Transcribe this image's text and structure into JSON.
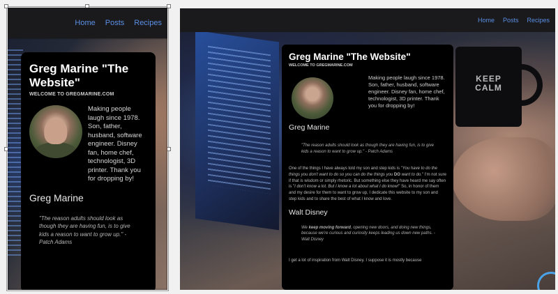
{
  "nav": {
    "items": [
      "Home",
      "Posts",
      "Recipes"
    ],
    "link_color": "#5b8fe5"
  },
  "site": {
    "title": "Greg Marine \"The Website\"",
    "subtitle": "WELCOME TO GREGMARINE.COM",
    "bio": "Making people laugh since 1978. Son, father, husband, software engineer. Disney fan, home chef, technologist, 3D printer. Thank you for dropping by!",
    "author_name": "Greg Marine",
    "quote1": "\"The reason adults should look as though they are having fun, is to give kids a reason to want to grow up.\" - Patch Adams",
    "para1_a": "One of the things I have always told my son and step kids is \"",
    "para1_em1": "You have to do the things you don't want to do so you can do the things you ",
    "para1_b": "DO",
    "para1_em2": " want to do.",
    "para1_c": "\" I'm not sure if that is wisdom or simply rhetoric. But something else they have heard me say often is \"",
    "para1_em3": "I don't know a lot. But I know a lot about what I do know!",
    "para1_d": "\" So, in honor of them and my desire for them to want to grow up, I dedicate this website to my son and step kids and to share the best of what I know and love.",
    "name2": "Walt Disney",
    "quote2_a": "We ",
    "quote2_bold": "keep moving forward",
    "quote2_b": ", opening new doors, and doing new things, because we're curious and curiosity keeps leading us down new paths. - Walt Disney",
    "para2": "I get a lot of inspiration from Walt Disney. I suppose it is mostly because"
  },
  "background": {
    "mug_text": "KEEP CALM"
  },
  "colors": {
    "card_bg": "#000000",
    "nav_bg": "#1a1a1c",
    "page_bg": "#f1f1f1",
    "accent_ring": "#4aa3e8"
  }
}
